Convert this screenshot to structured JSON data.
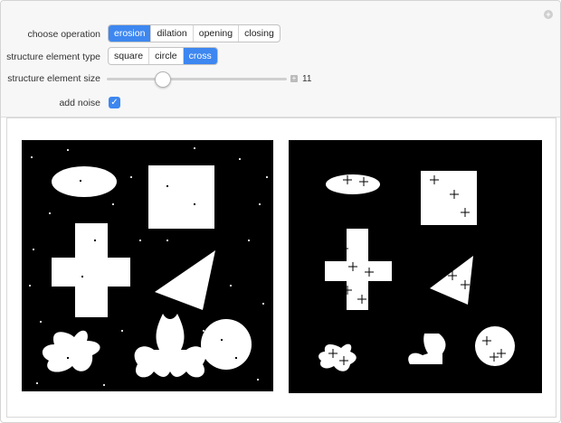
{
  "controls": {
    "operation_label": "choose operation",
    "operations": [
      "erosion",
      "dilation",
      "opening",
      "closing"
    ],
    "operation_selected": "erosion",
    "structure_type_label": "structure element type",
    "structure_types": [
      "square",
      "circle",
      "cross"
    ],
    "structure_type_selected": "cross",
    "size_label": "structure element size",
    "size_value": "11",
    "noise_label": "add noise",
    "noise_checked": true
  },
  "icons": {
    "corner_plus": "plus-icon",
    "slider_plus": "plus-icon",
    "checkbox_check": "check-icon"
  },
  "colors": {
    "accent": "#3d87f0",
    "image_bg": "#000000",
    "shape": "#ffffff"
  }
}
